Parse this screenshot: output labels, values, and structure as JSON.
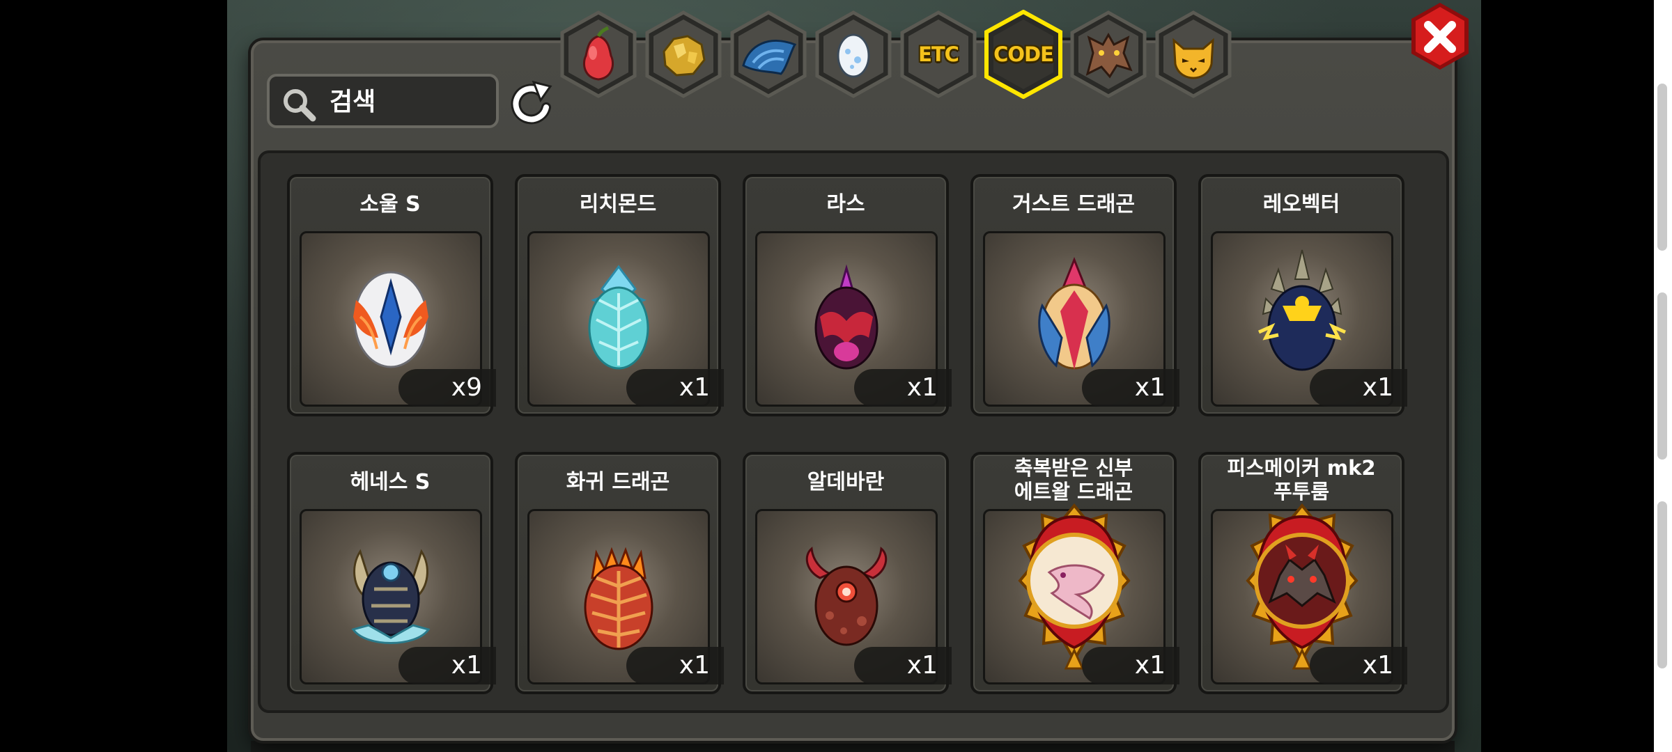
{
  "search": {
    "placeholder": "검색"
  },
  "tabs": [
    {
      "id": "fruit",
      "icon": "pear-icon"
    },
    {
      "id": "gold",
      "icon": "gold-ore-icon"
    },
    {
      "id": "scale",
      "icon": "blue-scale-icon"
    },
    {
      "id": "egg",
      "icon": "egg-icon"
    },
    {
      "id": "etc",
      "label": "ETC"
    },
    {
      "id": "code",
      "label": "CODE",
      "selected": true
    },
    {
      "id": "dragon",
      "icon": "dragon-head-icon"
    },
    {
      "id": "cat",
      "icon": "cat-face-icon"
    }
  ],
  "items": [
    {
      "name": "소울 S",
      "qty": "x9",
      "icon": "soul-s-egg-icon"
    },
    {
      "name": "리치몬드",
      "qty": "x1",
      "icon": "richmond-egg-icon"
    },
    {
      "name": "라스",
      "qty": "x1",
      "icon": "ras-egg-icon"
    },
    {
      "name": "거스트 드래곤",
      "qty": "x1",
      "icon": "gust-dragon-egg-icon"
    },
    {
      "name": "레오벡터",
      "qty": "x1",
      "icon": "leovector-egg-icon"
    },
    {
      "name": "헤네스 S",
      "qty": "x1",
      "icon": "henes-s-egg-icon"
    },
    {
      "name": "화귀 드래곤",
      "qty": "x1",
      "icon": "fire-dragon-egg-icon"
    },
    {
      "name": "알데바란",
      "qty": "x1",
      "icon": "aldebaran-egg-icon"
    },
    {
      "name": "축복받은 신부\n에트왈 드래곤",
      "qty": "x1",
      "icon": "blessed-bride-etoile-dragon-emblem-icon"
    },
    {
      "name": "피스메이커 mk2\n푸투룸",
      "qty": "x1",
      "icon": "peacemaker-mk2-futurum-emblem-icon"
    }
  ],
  "colors": {
    "panel": "#43433e",
    "tab_highlight": "#ffe600",
    "tab_label": "#f4c21c",
    "close_button": "#d01a1a"
  }
}
